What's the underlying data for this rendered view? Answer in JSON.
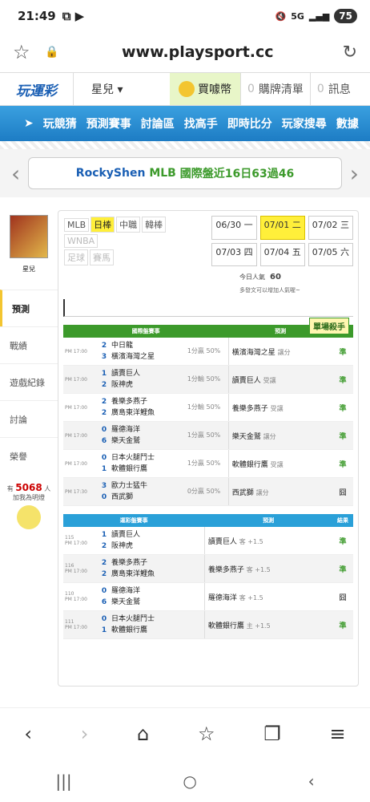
{
  "status": {
    "time": "21:49",
    "battery": "75",
    "signal": "5G"
  },
  "browser": {
    "url": "www.playsport.cc"
  },
  "topnav": {
    "logo": "玩運彩",
    "user": "星兒 ▾",
    "buy_coin": "買噱幣",
    "cart_count": "0",
    "cart": "購牌清單",
    "msg_count": "0",
    "msg": "訊息"
  },
  "menu": [
    "玩競猜",
    "預測賽事",
    "討論區",
    "找高手",
    "即時比分",
    "玩家搜尋",
    "數據"
  ],
  "banner": {
    "name": "RockyShen",
    "league": "MLB",
    "text": "國際盤近16日63過46"
  },
  "sidebar": {
    "user": "星兒",
    "tabs": [
      "預測",
      "戰績",
      "遊戲紀錄",
      "討論",
      "榮譽"
    ],
    "pop_prefix": "有",
    "pop_count": "5068",
    "pop_suffix": "人",
    "pop_caption": "加我為明燈"
  },
  "leagues": [
    {
      "label": "MLB",
      "state": "normal"
    },
    {
      "label": "日棒",
      "state": "on"
    },
    {
      "label": "中職",
      "state": "normal"
    },
    {
      "label": "韓棒",
      "state": "normal"
    },
    {
      "label": "WNBA",
      "state": "off"
    },
    {
      "label": "足球",
      "state": "off"
    },
    {
      "label": "賽馬",
      "state": "off"
    }
  ],
  "dates": [
    {
      "label": "06/30 一",
      "state": "normal"
    },
    {
      "label": "07/01 二",
      "state": "on"
    },
    {
      "label": "07/02 三",
      "state": "normal"
    },
    {
      "label": "07/03 四",
      "state": "normal"
    },
    {
      "label": "07/04 五",
      "state": "normal"
    },
    {
      "label": "07/05 六",
      "state": "normal"
    }
  ],
  "popularity": {
    "label": "今日人氣",
    "value": "60",
    "prompt": "多發文可以增加人氣喔~"
  },
  "killer_badge": "單場殺手",
  "intl_header": {
    "col1": "國際盤賽事",
    "col2": "預測",
    "col3": "結果"
  },
  "intl_rows": [
    {
      "time": "PM 17:00",
      "s1": "2",
      "s2": "3",
      "t1": "中日龍",
      "t2": "橫濱海灣之星",
      "odds": "1分贏 50%",
      "pick": "橫濱海灣之星",
      "note": "讓分",
      "res": "準"
    },
    {
      "time": "PM 17:00",
      "s1": "1",
      "s2": "2",
      "t1": "讀賣巨人",
      "t2": "阪神虎",
      "odds": "1分輸 50%",
      "pick": "讀賣巨人",
      "note": "受讓",
      "res": "準"
    },
    {
      "time": "PM 17:00",
      "s1": "2",
      "s2": "2",
      "t1": "養樂多燕子",
      "t2": "廣島東洋鯉魚",
      "odds": "1分輸 50%",
      "pick": "養樂多燕子",
      "note": "受讓",
      "res": "準"
    },
    {
      "time": "PM 17:00",
      "s1": "0",
      "s2": "6",
      "t1": "羅德海洋",
      "t2": "樂天金鷲",
      "odds": "1分贏 50%",
      "pick": "樂天金鷲",
      "note": "讓分",
      "res": "準"
    },
    {
      "time": "PM 17:00",
      "s1": "0",
      "s2": "1",
      "t1": "日本火腿鬥士",
      "t2": "軟體銀行鷹",
      "odds": "1分贏 50%",
      "pick": "軟體銀行鷹",
      "note": "受讓",
      "res": "準"
    },
    {
      "time": "PM 17:30",
      "s1": "3",
      "s2": "0",
      "t1": "歐力士猛牛",
      "t2": "西武獅",
      "odds": "0分贏 50%",
      "pick": "西武獅",
      "note": "讓分",
      "res": "囧"
    }
  ],
  "tw_header": {
    "col1": "運彩盤賽事",
    "col2": "預測",
    "col3": "結果"
  },
  "tw_rows": [
    {
      "no": "115",
      "time": "PM 17:00",
      "s1": "1",
      "s2": "2",
      "t1": "讀賣巨人",
      "t2": "阪神虎",
      "pick": "讀賣巨人",
      "note": "客 +1.5",
      "res": "準"
    },
    {
      "no": "116",
      "time": "PM 17:00",
      "s1": "2",
      "s2": "2",
      "t1": "養樂多燕子",
      "t2": "廣島東洋鯉魚",
      "pick": "養樂多燕子",
      "note": "客 +1.5",
      "res": "準"
    },
    {
      "no": "110",
      "time": "PM 17:00",
      "s1": "0",
      "s2": "6",
      "t1": "羅德海洋",
      "t2": "樂天金鷲",
      "pick": "羅德海洋",
      "note": "客 +1.5",
      "res": "囧"
    },
    {
      "no": "111",
      "time": "PM 17:00",
      "s1": "0",
      "s2": "1",
      "t1": "日本火腿鬥士",
      "t2": "軟體銀行鷹",
      "pick": "軟體銀行鷹",
      "note": "主 +1.5",
      "res": "準"
    }
  ]
}
